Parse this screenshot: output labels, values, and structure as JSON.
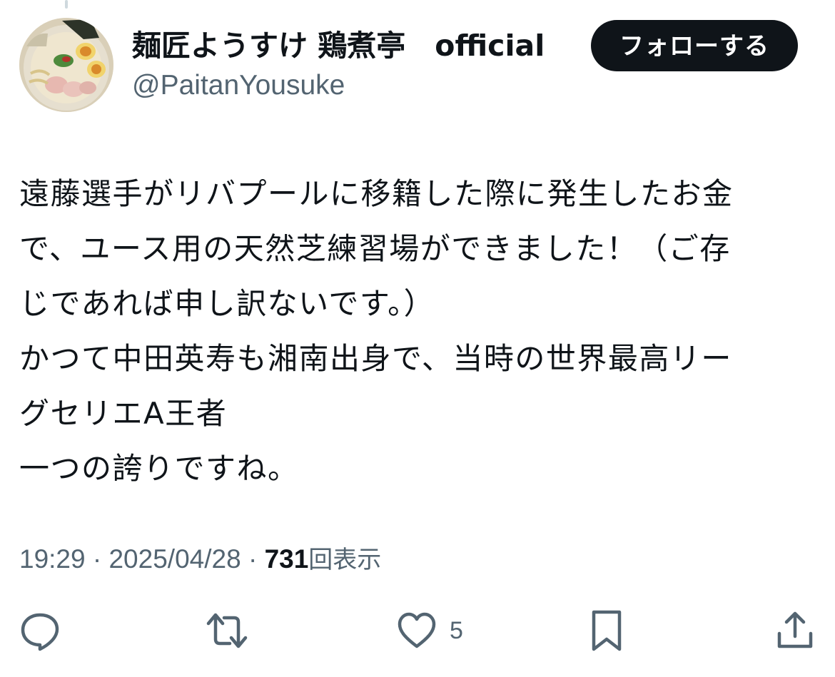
{
  "author": {
    "display_name": "麺匠ようすけ 鶏煮亭　official",
    "handle": "@PaitanYousuke",
    "avatar_icon": "ramen-bowl-icon"
  },
  "follow_button": {
    "label": "フォローする"
  },
  "tweet": {
    "lines": [
      "遠藤選手がリバプールに移籍した際に発生したお金",
      "で、ユース用の天然芝練習場ができました！（ご存",
      "じであれば申し訳ないです。）",
      "かつて中田英寿も湘南出身で、当時の世界最高リー",
      "グセリエA王者",
      "一つの誇りですね。"
    ]
  },
  "meta": {
    "time": "19:29",
    "separator": " · ",
    "date": "2025/04/28",
    "views_count": "731",
    "views_label": "回表示"
  },
  "actions": {
    "reply": {
      "icon": "reply-icon",
      "count": ""
    },
    "retweet": {
      "icon": "retweet-icon",
      "count": ""
    },
    "like": {
      "icon": "heart-icon",
      "count": "5"
    },
    "bookmark": {
      "icon": "bookmark-icon",
      "count": ""
    },
    "share": {
      "icon": "share-icon",
      "count": ""
    }
  },
  "colors": {
    "text": "#0f1419",
    "secondary": "#536471",
    "button_bg": "#0f1419",
    "button_text": "#ffffff"
  }
}
